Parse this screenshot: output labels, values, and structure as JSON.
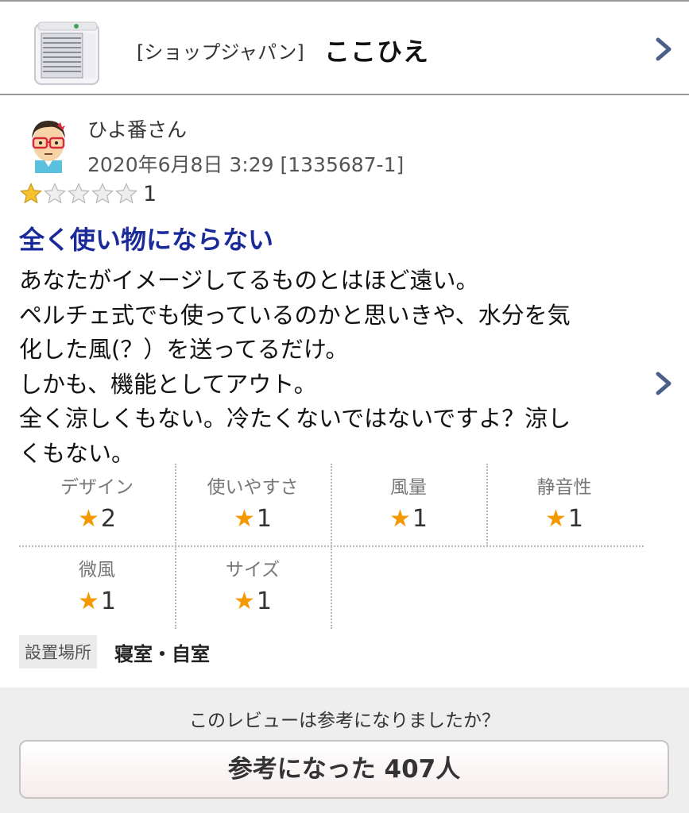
{
  "product": {
    "shop": "[ショップジャパン]",
    "name": "ここひえ"
  },
  "review": {
    "reviewer": "ひよ番さん",
    "date": "2020年6月8日 3:29 [1335687-1]",
    "stars_filled": 1,
    "stars_total": 5,
    "score": "1",
    "title": "全く使い物にならない",
    "body_lines": [
      "あなたがイメージしてるものとはほど遠い。",
      "ペルチェ式でも使っているのかと思いきや、水分を気",
      "化した風(？）を送ってるだけ。",
      "しかも、機能としてアウト。",
      "全く涼しくもない。冷たくないではないですよ？涼し",
      "くもない。"
    ]
  },
  "ratings": [
    {
      "label": "デザイン",
      "star": "★",
      "value": "2"
    },
    {
      "label": "使いやすさ",
      "star": "★",
      "value": "1"
    },
    {
      "label": "風量",
      "star": "★",
      "value": "1"
    },
    {
      "label": "静音性",
      "star": "★",
      "value": "1"
    },
    {
      "label": "微風",
      "star": "★",
      "value": "1"
    },
    {
      "label": "サイズ",
      "star": "★",
      "value": "1"
    }
  ],
  "location": {
    "label": "設置場所",
    "value": "寝室・自室"
  },
  "helpful": {
    "question": "このレビューは参考になりましたか？",
    "button_label": "参考になった 407人"
  },
  "colors": {
    "title": "#1a2a99",
    "star": "#f39800",
    "chevron": "#4a5f8a"
  }
}
